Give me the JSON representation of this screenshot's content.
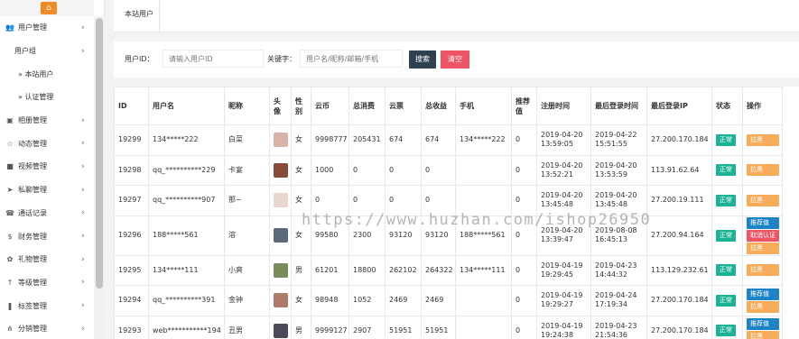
{
  "sidebar": {
    "logo_icon": "home-icon",
    "items": [
      {
        "label": "用户管理",
        "icon": "users-icon"
      },
      {
        "label": "用户组"
      },
      {
        "label": "» 本站用户"
      },
      {
        "label": "» 认证管理"
      },
      {
        "label": "相册管理",
        "icon": "image-icon"
      },
      {
        "label": "动态管理",
        "icon": "star-icon"
      },
      {
        "label": "视频管理",
        "icon": "video-icon"
      },
      {
        "label": "私聊管理",
        "icon": "send-icon"
      },
      {
        "label": "通话记录",
        "icon": "phone-icon"
      },
      {
        "label": "财务管理",
        "icon": "money-icon"
      },
      {
        "label": "礼物管理",
        "icon": "gift-icon"
      },
      {
        "label": "等级管理",
        "icon": "level-icon"
      },
      {
        "label": "标签管理",
        "icon": "bookmark-icon"
      },
      {
        "label": "分销管理",
        "icon": "share-icon"
      }
    ]
  },
  "tabs": {
    "active": "本站用户"
  },
  "search": {
    "userid_label": "用户ID：",
    "userid_placeholder": "请输入用户ID",
    "keyword_label": "关键字：",
    "keyword_placeholder": "用户名/昵称/邮箱/手机",
    "search_button": "搜索",
    "clear_button": "清空"
  },
  "table": {
    "headers": [
      "ID",
      "用户名",
      "昵称",
      "头像",
      "性别",
      "云币",
      "总消费",
      "云票",
      "总收益",
      "手机",
      "推荐值",
      "注册时间",
      "最后登录时间",
      "最后登录IP",
      "状态",
      "操作"
    ],
    "rows": [
      {
        "id": "19299",
        "username": "134*****222",
        "nickname": "白菜",
        "gender": "女",
        "coins": "9998777",
        "spend": "205431",
        "tickets": "674",
        "income": "674",
        "phone": "134*****222",
        "rec": "0",
        "reg": "2019-04-20 13:59:05",
        "last": "2019-04-22 15:51:55",
        "ip": "27.200.170.184",
        "status": "正常",
        "ops": [
          "拉黑"
        ]
      },
      {
        "id": "19298",
        "username": "qq_**********229",
        "nickname": "卡宴",
        "gender": "女",
        "coins": "1000",
        "spend": "0",
        "tickets": "0",
        "income": "0",
        "phone": "",
        "rec": "0",
        "reg": "2019-04-20 13:52:21",
        "last": "2019-04-20 13:53:59",
        "ip": "113.91.62.64",
        "status": "正常",
        "ops": [
          "拉黑"
        ]
      },
      {
        "id": "19297",
        "username": "qq_**********907",
        "nickname": "那~",
        "gender": "女",
        "coins": "0",
        "spend": "0",
        "tickets": "0",
        "income": "0",
        "phone": "",
        "rec": "0",
        "reg": "2019-04-20 13:45:48",
        "last": "2019-04-20 13:45:48",
        "ip": "27.200.19.111",
        "status": "正常",
        "ops": [
          "拉黑"
        ]
      },
      {
        "id": "19296",
        "username": "188*****561",
        "nickname": "溶",
        "gender": "女",
        "coins": "99580",
        "spend": "2300",
        "tickets": "93120",
        "income": "93120",
        "phone": "188*****561",
        "rec": "0",
        "reg": "2019-04-20 13:39:47",
        "last": "2019-08-08 16:45:13",
        "ip": "27.200.94.164",
        "status": "正常",
        "ops": [
          "推荐值",
          "取消认证",
          "拉黑"
        ]
      },
      {
        "id": "19295",
        "username": "134*****111",
        "nickname": "小爽",
        "gender": "男",
        "coins": "61201",
        "spend": "18800",
        "tickets": "262102",
        "income": "264322",
        "phone": "134*****111",
        "rec": "0",
        "reg": "2019-04-19 19:29:45",
        "last": "2019-04-23 14:44:32",
        "ip": "113.129.232.61",
        "status": "正常",
        "ops": [
          "拉黑"
        ]
      },
      {
        "id": "19294",
        "username": "qq_**********391",
        "nickname": "金钟",
        "gender": "女",
        "coins": "98948",
        "spend": "1052",
        "tickets": "2469",
        "income": "2469",
        "phone": "",
        "rec": "0",
        "reg": "2019-04-19 19:29:27",
        "last": "2019-04-24 17:19:34",
        "ip": "27.200.170.184",
        "status": "正常",
        "ops": [
          "推荐值",
          "拉黑"
        ]
      },
      {
        "id": "19293",
        "username": "web***********194",
        "nickname": "丑男",
        "gender": "男",
        "coins": "9999127",
        "spend": "2907",
        "tickets": "51951",
        "income": "51951",
        "phone": "",
        "rec": "0",
        "reg": "2019-04-19 19:24:38",
        "last": "2019-04-23 21:54:36",
        "ip": "27.200.170.184",
        "status": "正常",
        "ops": [
          "推荐值",
          "拉黑"
        ]
      }
    ]
  },
  "watermark": "https://www.huzhan.com/ishop26950",
  "colors": {
    "status_green": "#1ab394",
    "op_orange": "#f8ac59",
    "op_blue": "#1c84c6",
    "op_red": "#ed5565",
    "search_btn": "#2f4050"
  }
}
